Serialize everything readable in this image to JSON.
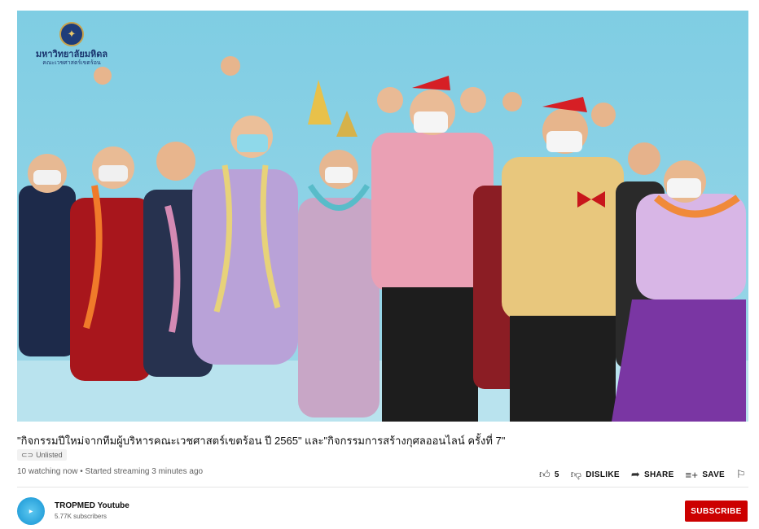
{
  "video": {
    "logo_text": "มหาวิทยาลัยมหิดล",
    "logo_subtext": "คณะเวชศาสตร์เขตร้อน"
  },
  "title": "\"กิจกรรมปีใหม่จากทีมผู้บริหารคณะเวชศาสตร์เขตร้อน ปี 2565\" และ\"กิจกรรมการสร้างกุศลออนไลน์ ครั้งที่ 7\"",
  "badge": {
    "label": "Unlisted",
    "icon": "link-icon"
  },
  "meta": {
    "text": "10 watching now • Started streaming 3 minutes ago"
  },
  "actions": {
    "like_count": "5",
    "dislike_label": "DISLIKE",
    "share_label": "SHARE",
    "save_label": "SAVE"
  },
  "channel": {
    "name": "TROPMED Youtube",
    "subscribers": "5.77K subscribers"
  },
  "subscribe_label": "SUBSCRIBE",
  "colors": {
    "subscribe": "#cc0000",
    "video_bg": "#8fd3e6"
  }
}
